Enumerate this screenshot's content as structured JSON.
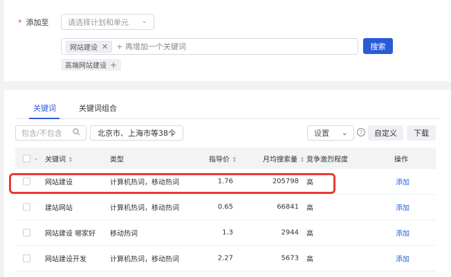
{
  "add_to": {
    "required_mark": "*",
    "label": "添加至",
    "plan_select_placeholder": "请选择计划和单元"
  },
  "keyword_input": {
    "tags": [
      {
        "text": "网站建设"
      }
    ],
    "add_more_text": "+ 再增加一个关键词",
    "search_button": "搜索"
  },
  "suggested_tags": [
    {
      "text": "高端网站建设"
    }
  ],
  "tabs": [
    {
      "label": "关键词",
      "active": true
    },
    {
      "label": "关键词组合",
      "active": false
    }
  ],
  "filters": {
    "include_exclude_placeholder": "包含/不包含",
    "region": "北京市、上海市等38个",
    "settings": "设置",
    "custom_button": "自定义",
    "download_button": "下载"
  },
  "table": {
    "headers": {
      "keyword": "关键词",
      "type": "类型",
      "price": "指导价",
      "volume": "月均搜索量",
      "competition": "竞争激烈程度",
      "action": "操作"
    },
    "rows": [
      {
        "keyword": "网站建设",
        "type": "计算机热词，移动热词",
        "price": "1.76",
        "volume": "205798",
        "competition": "高",
        "action": "添加"
      },
      {
        "keyword": "建站网站",
        "type": "计算机热词，移动热词",
        "price": "0.65",
        "volume": "66841",
        "competition": "高",
        "action": "添加"
      },
      {
        "keyword": "网站建设 哪家好",
        "type": "移动热词",
        "price": "1.3",
        "volume": "2944",
        "competition": "高",
        "action": "添加"
      },
      {
        "keyword": "网站建设开发",
        "type": "计算机热词，移动热词",
        "price": "2.27",
        "volume": "5673",
        "competition": "高",
        "action": "添加"
      }
    ]
  },
  "colors": {
    "accent": "#2a5bd7",
    "highlight": "#e83a2e",
    "required": "#e53935"
  },
  "icons": {
    "tag_remove": "close-icon",
    "select": "chevron-down-icon",
    "search": "search-icon",
    "help": "question-circle-icon",
    "sort": "sort-icon"
  }
}
